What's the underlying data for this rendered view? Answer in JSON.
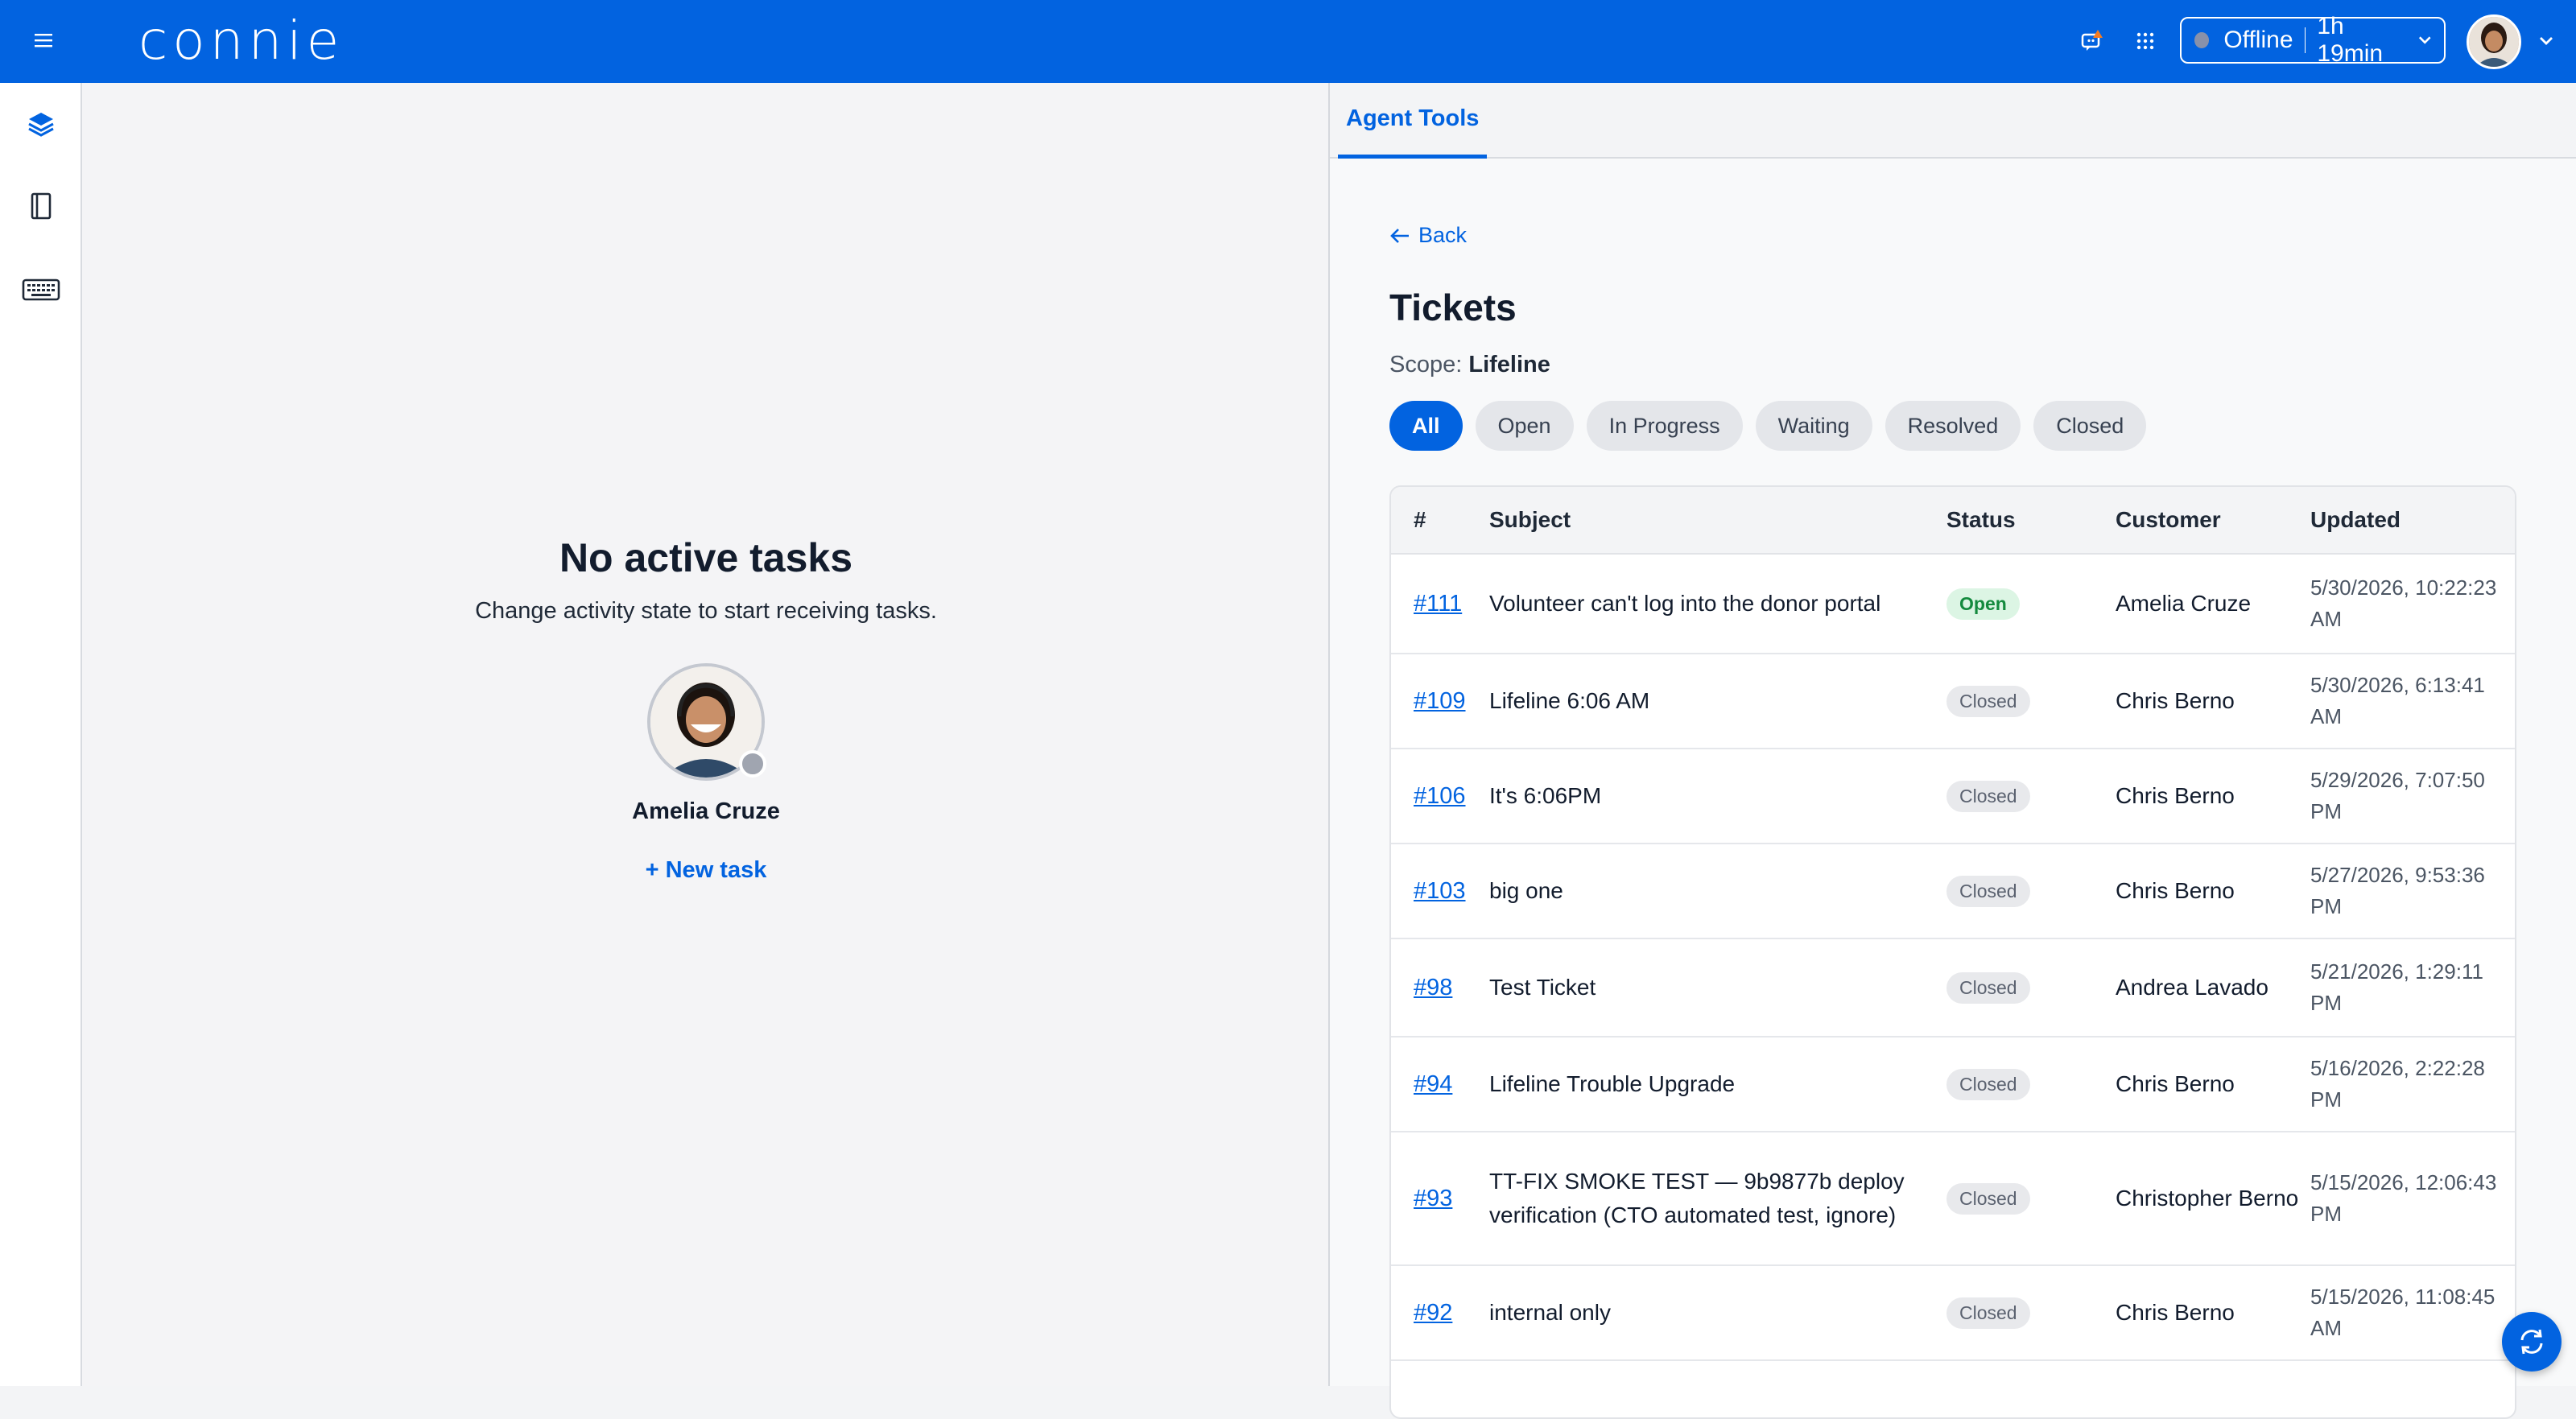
{
  "brand": {
    "logo_text": "connie",
    "primary_color": "#0263e0"
  },
  "topbar": {
    "menu_icon": "hamburger-icon",
    "notification_icon": "chat-alert-icon",
    "apps_icon": "grid-dots-icon",
    "status": {
      "state": "Offline",
      "duration": "1h 19min"
    },
    "avatar_icon": "user-avatar",
    "chevron_icon": "chevron-down-icon"
  },
  "sidenav": {
    "items": [
      {
        "icon": "layers-icon",
        "active": true
      },
      {
        "icon": "notebook-icon",
        "active": false
      },
      {
        "icon": "keyboard-icon",
        "active": false
      }
    ]
  },
  "left": {
    "title": "No active tasks",
    "subtitle": "Change activity state to start receiving tasks.",
    "agent_name": "Amelia Cruze",
    "new_task_label": "+ New task"
  },
  "right": {
    "tab_label": "Agent Tools",
    "back_label": "Back",
    "page_title": "Tickets",
    "scope_label": "Scope:",
    "scope_value": "Lifeline",
    "filters": [
      "All",
      "Open",
      "In Progress",
      "Waiting",
      "Resolved",
      "Closed"
    ],
    "active_filter": "All",
    "columns": [
      "#",
      "Subject",
      "Status",
      "Customer",
      "Updated"
    ],
    "rows": [
      {
        "id": "#111",
        "subject": "Volunteer can't log into the donor portal",
        "status": "Open",
        "customer": "Amelia Cruze",
        "updated": "5/30/2026, 10:22:23 AM"
      },
      {
        "id": "#109",
        "subject": "Lifeline 6:06 AM",
        "status": "Closed",
        "customer": "Chris Berno",
        "updated": "5/30/2026, 6:13:41 AM"
      },
      {
        "id": "#106",
        "subject": "It's 6:06PM",
        "status": "Closed",
        "customer": "Chris Berno",
        "updated": "5/29/2026, 7:07:50 PM"
      },
      {
        "id": "#103",
        "subject": "big one",
        "status": "Closed",
        "customer": "Chris Berno",
        "updated": "5/27/2026, 9:53:36 PM"
      },
      {
        "id": "#98",
        "subject": "Test Ticket",
        "status": "Closed",
        "customer": "Andrea Lavado",
        "updated": "5/21/2026, 1:29:11 PM"
      },
      {
        "id": "#94",
        "subject": "Lifeline Trouble Upgrade",
        "status": "Closed",
        "customer": "Chris Berno",
        "updated": "5/16/2026, 2:22:28 PM"
      },
      {
        "id": "#93",
        "subject": "TT-FIX SMOKE TEST — 9b9877b deploy verification (CTO automated test, ignore)",
        "status": "Closed",
        "customer": "Christopher Berno",
        "updated": "5/15/2026, 12:06:43 PM"
      },
      {
        "id": "#92",
        "subject": "internal only",
        "status": "Closed",
        "customer": "Chris Berno",
        "updated": "5/15/2026, 11:08:45 AM"
      }
    ]
  },
  "fab_icon": "refresh-icon"
}
